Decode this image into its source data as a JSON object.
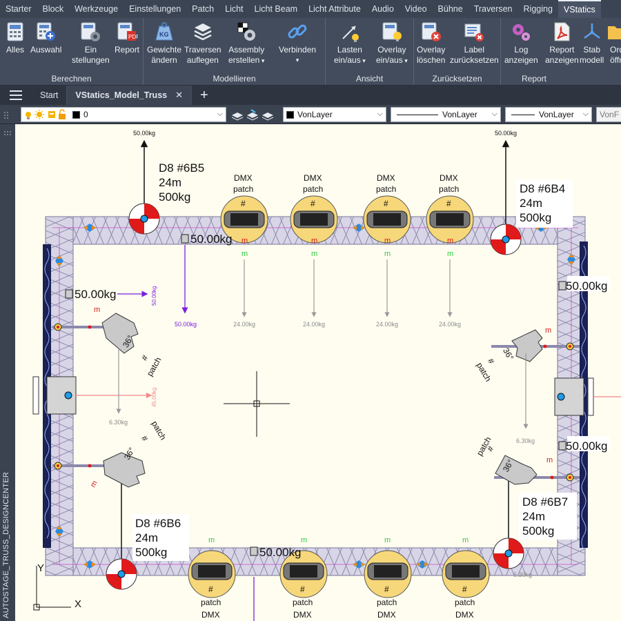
{
  "ribbon_tabs": [
    "Starter",
    "Block",
    "Werkzeuge",
    "Einstellungen",
    "Patch",
    "Licht",
    "Licht Beam",
    "Licht Attribute",
    "Audio",
    "Video",
    "Bühne",
    "Traversen",
    "Rigging",
    "VStatics"
  ],
  "ribbon_groups": {
    "berechnen": {
      "label": "Berechnen",
      "alles": "Alles",
      "auswahl": "Auswahl",
      "einstellungen_1": "Ein",
      "einstellungen_2": "stellungen",
      "report": "Report"
    },
    "modellieren": {
      "label": "Modellieren",
      "gewichte_1": "Gewichte",
      "gewichte_2": "ändern",
      "traversen_1": "Traversen",
      "traversen_2": "auflegen",
      "assembly_1": "Assembly",
      "assembly_2": "erstellen",
      "verbinden": "Verbinden"
    },
    "ansicht": {
      "label": "Ansicht",
      "lasten_1": "Lasten",
      "lasten_2": "ein/aus",
      "overlay_1": "Overlay",
      "overlay_2": "ein/aus"
    },
    "zuruecksetzen": {
      "label": "Zurücksetzen",
      "overlay_loeschen_1": "Overlay",
      "overlay_loeschen_2": "löschen",
      "label_zurueck_1": "Label",
      "label_zurueck_2": "zurücksetzen"
    },
    "report": {
      "label": "Report",
      "log_1": "Log",
      "log_2": "anzeigen",
      "report_1": "Report",
      "report_2": "anzeigen",
      "stab_1": "Stab",
      "stab_2": "modell",
      "ordner_1": "Ord",
      "ordner_2": "öffn"
    }
  },
  "doc_tabs": {
    "start": "Start",
    "model": "VStatics_Model_Truss",
    "close": "✕",
    "add": "+"
  },
  "toolbar": {
    "layer_value": "0",
    "color_value": "VonLayer",
    "linetype_value": "VonLayer",
    "lineweight_value": "VonLayer",
    "extra_value": "VonF"
  },
  "side_panel": "AUTOSTAGE_TRUSS_DESIGNCENTER",
  "drawing": {
    "load_top_left": "50.00kg",
    "load_top_right": "50.00kg",
    "motor_6b5": [
      "D8  #6B5",
      "24m",
      "500kg"
    ],
    "motor_6b4": [
      "D8  #6B4",
      "24m",
      "500kg"
    ],
    "motor_6b6": [
      "D8  #6B6",
      "24m",
      "500kg"
    ],
    "motor_6b7": [
      "D8  #6B7",
      "24m",
      "500kg"
    ],
    "point_loads": [
      "50.00kg",
      "50.00kg",
      "50.00kg",
      "50.00kg",
      "50.00kg"
    ],
    "small_loads": [
      "50.00kg",
      "50.00kg",
      "45.00kg"
    ],
    "fixture_loads": [
      "24.00kg",
      "24.00kg",
      "24.00kg",
      "24.00kg"
    ],
    "spot_loads": [
      "6.30kg",
      "6.30kg",
      "6.30kg"
    ],
    "dmx_word": "DMX",
    "patch_word": "patch",
    "hash": "#",
    "m_marker": "m",
    "spot_angle": "36°",
    "ucs_x": "X",
    "ucs_y": "Y"
  },
  "colors": {
    "canvas_bg": "#fffdf0",
    "truss": "#9a98b8",
    "motor_red": "#e01a1a",
    "fixture_fill": "#f6d77a",
    "load_purple": "#7a1ee0",
    "load_grey": "#9a9a9a",
    "ribbon_bg": "#434c5c"
  }
}
